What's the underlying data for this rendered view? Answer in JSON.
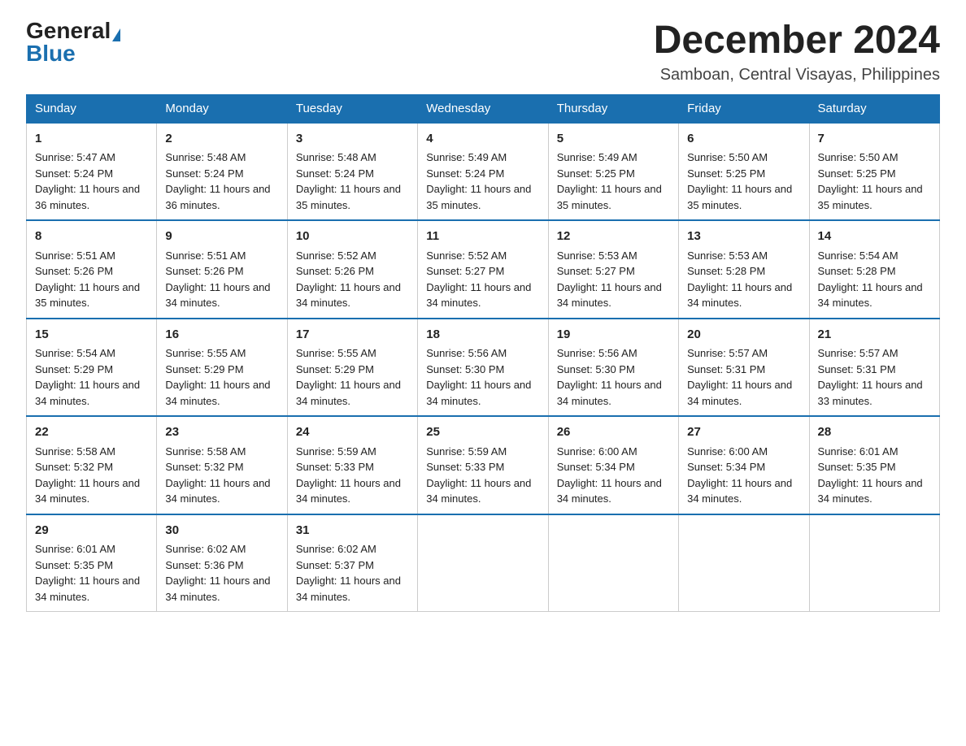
{
  "header": {
    "logo_general": "General",
    "logo_blue": "Blue",
    "month_title": "December 2024",
    "location": "Samboan, Central Visayas, Philippines"
  },
  "days_of_week": [
    "Sunday",
    "Monday",
    "Tuesday",
    "Wednesday",
    "Thursday",
    "Friday",
    "Saturday"
  ],
  "weeks": [
    [
      {
        "day": "1",
        "sunrise": "5:47 AM",
        "sunset": "5:24 PM",
        "daylight": "11 hours and 36 minutes."
      },
      {
        "day": "2",
        "sunrise": "5:48 AM",
        "sunset": "5:24 PM",
        "daylight": "11 hours and 36 minutes."
      },
      {
        "day": "3",
        "sunrise": "5:48 AM",
        "sunset": "5:24 PM",
        "daylight": "11 hours and 35 minutes."
      },
      {
        "day": "4",
        "sunrise": "5:49 AM",
        "sunset": "5:24 PM",
        "daylight": "11 hours and 35 minutes."
      },
      {
        "day": "5",
        "sunrise": "5:49 AM",
        "sunset": "5:25 PM",
        "daylight": "11 hours and 35 minutes."
      },
      {
        "day": "6",
        "sunrise": "5:50 AM",
        "sunset": "5:25 PM",
        "daylight": "11 hours and 35 minutes."
      },
      {
        "day": "7",
        "sunrise": "5:50 AM",
        "sunset": "5:25 PM",
        "daylight": "11 hours and 35 minutes."
      }
    ],
    [
      {
        "day": "8",
        "sunrise": "5:51 AM",
        "sunset": "5:26 PM",
        "daylight": "11 hours and 35 minutes."
      },
      {
        "day": "9",
        "sunrise": "5:51 AM",
        "sunset": "5:26 PM",
        "daylight": "11 hours and 34 minutes."
      },
      {
        "day": "10",
        "sunrise": "5:52 AM",
        "sunset": "5:26 PM",
        "daylight": "11 hours and 34 minutes."
      },
      {
        "day": "11",
        "sunrise": "5:52 AM",
        "sunset": "5:27 PM",
        "daylight": "11 hours and 34 minutes."
      },
      {
        "day": "12",
        "sunrise": "5:53 AM",
        "sunset": "5:27 PM",
        "daylight": "11 hours and 34 minutes."
      },
      {
        "day": "13",
        "sunrise": "5:53 AM",
        "sunset": "5:28 PM",
        "daylight": "11 hours and 34 minutes."
      },
      {
        "day": "14",
        "sunrise": "5:54 AM",
        "sunset": "5:28 PM",
        "daylight": "11 hours and 34 minutes."
      }
    ],
    [
      {
        "day": "15",
        "sunrise": "5:54 AM",
        "sunset": "5:29 PM",
        "daylight": "11 hours and 34 minutes."
      },
      {
        "day": "16",
        "sunrise": "5:55 AM",
        "sunset": "5:29 PM",
        "daylight": "11 hours and 34 minutes."
      },
      {
        "day": "17",
        "sunrise": "5:55 AM",
        "sunset": "5:29 PM",
        "daylight": "11 hours and 34 minutes."
      },
      {
        "day": "18",
        "sunrise": "5:56 AM",
        "sunset": "5:30 PM",
        "daylight": "11 hours and 34 minutes."
      },
      {
        "day": "19",
        "sunrise": "5:56 AM",
        "sunset": "5:30 PM",
        "daylight": "11 hours and 34 minutes."
      },
      {
        "day": "20",
        "sunrise": "5:57 AM",
        "sunset": "5:31 PM",
        "daylight": "11 hours and 34 minutes."
      },
      {
        "day": "21",
        "sunrise": "5:57 AM",
        "sunset": "5:31 PM",
        "daylight": "11 hours and 33 minutes."
      }
    ],
    [
      {
        "day": "22",
        "sunrise": "5:58 AM",
        "sunset": "5:32 PM",
        "daylight": "11 hours and 34 minutes."
      },
      {
        "day": "23",
        "sunrise": "5:58 AM",
        "sunset": "5:32 PM",
        "daylight": "11 hours and 34 minutes."
      },
      {
        "day": "24",
        "sunrise": "5:59 AM",
        "sunset": "5:33 PM",
        "daylight": "11 hours and 34 minutes."
      },
      {
        "day": "25",
        "sunrise": "5:59 AM",
        "sunset": "5:33 PM",
        "daylight": "11 hours and 34 minutes."
      },
      {
        "day": "26",
        "sunrise": "6:00 AM",
        "sunset": "5:34 PM",
        "daylight": "11 hours and 34 minutes."
      },
      {
        "day": "27",
        "sunrise": "6:00 AM",
        "sunset": "5:34 PM",
        "daylight": "11 hours and 34 minutes."
      },
      {
        "day": "28",
        "sunrise": "6:01 AM",
        "sunset": "5:35 PM",
        "daylight": "11 hours and 34 minutes."
      }
    ],
    [
      {
        "day": "29",
        "sunrise": "6:01 AM",
        "sunset": "5:35 PM",
        "daylight": "11 hours and 34 minutes."
      },
      {
        "day": "30",
        "sunrise": "6:02 AM",
        "sunset": "5:36 PM",
        "daylight": "11 hours and 34 minutes."
      },
      {
        "day": "31",
        "sunrise": "6:02 AM",
        "sunset": "5:37 PM",
        "daylight": "11 hours and 34 minutes."
      },
      null,
      null,
      null,
      null
    ]
  ],
  "labels": {
    "sunrise": "Sunrise:",
    "sunset": "Sunset:",
    "daylight": "Daylight:"
  }
}
